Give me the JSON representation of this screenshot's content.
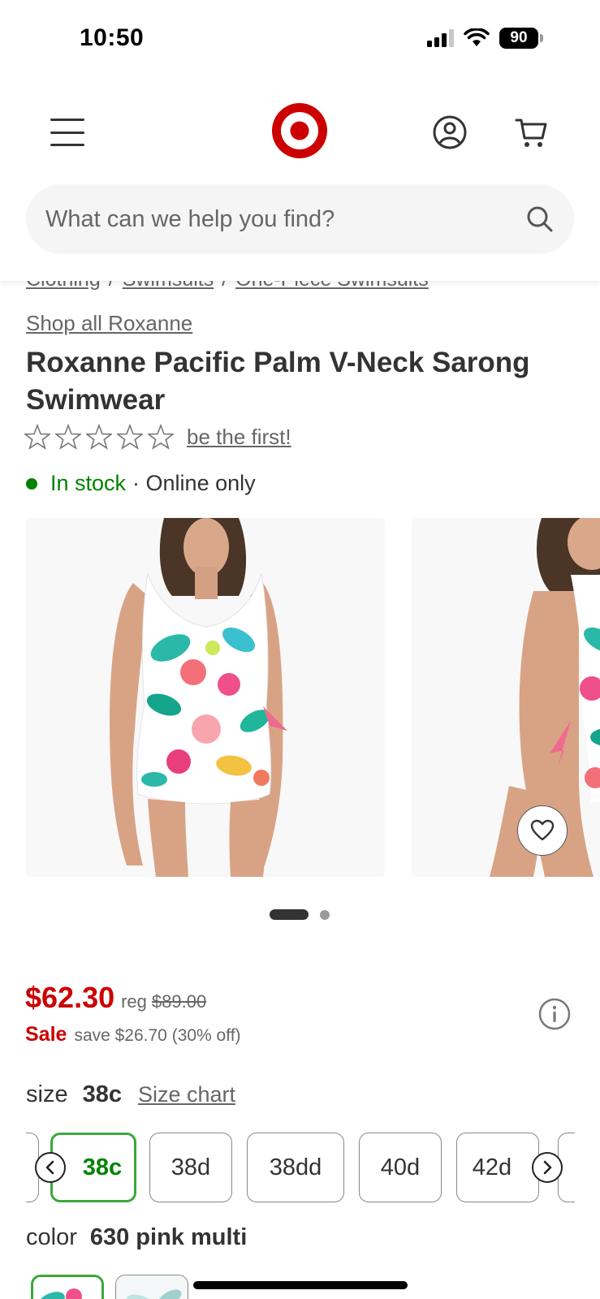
{
  "status_bar": {
    "time": "10:50",
    "battery": "90"
  },
  "header": {
    "logo_name": "target-bullseye",
    "brand_color": "#cc0000"
  },
  "search": {
    "placeholder": "What can we help you find?"
  },
  "breadcrumb": [
    "Clothing",
    "Swimsuits",
    "One-Piece Swimsuits"
  ],
  "product": {
    "shop_all": "Shop all Roxanne",
    "title": "Roxanne Pacific Palm V-Neck Sarong Swimwear",
    "rating_link": "be the first!",
    "stock": "In stock",
    "availability": "· Online only",
    "price": "$62.30",
    "reg_label": "reg",
    "reg_price": "$89.00",
    "sale_label": "Sale",
    "save_text": "save $26.70 (30% off)",
    "size_label": "size",
    "size_selected": "38c",
    "size_chart": "Size chart",
    "sizes": [
      "38c",
      "38d",
      "38dd",
      "40d",
      "42d"
    ],
    "color_label": "color",
    "color_selected": "630 pink multi"
  },
  "gallery": {
    "image_count": 2,
    "active_index": 0
  },
  "icons": [
    "menu-icon",
    "account-icon",
    "cart-icon",
    "search-icon",
    "star-icon",
    "heart-icon",
    "info-icon",
    "chevron-left-icon",
    "chevron-right-icon"
  ]
}
